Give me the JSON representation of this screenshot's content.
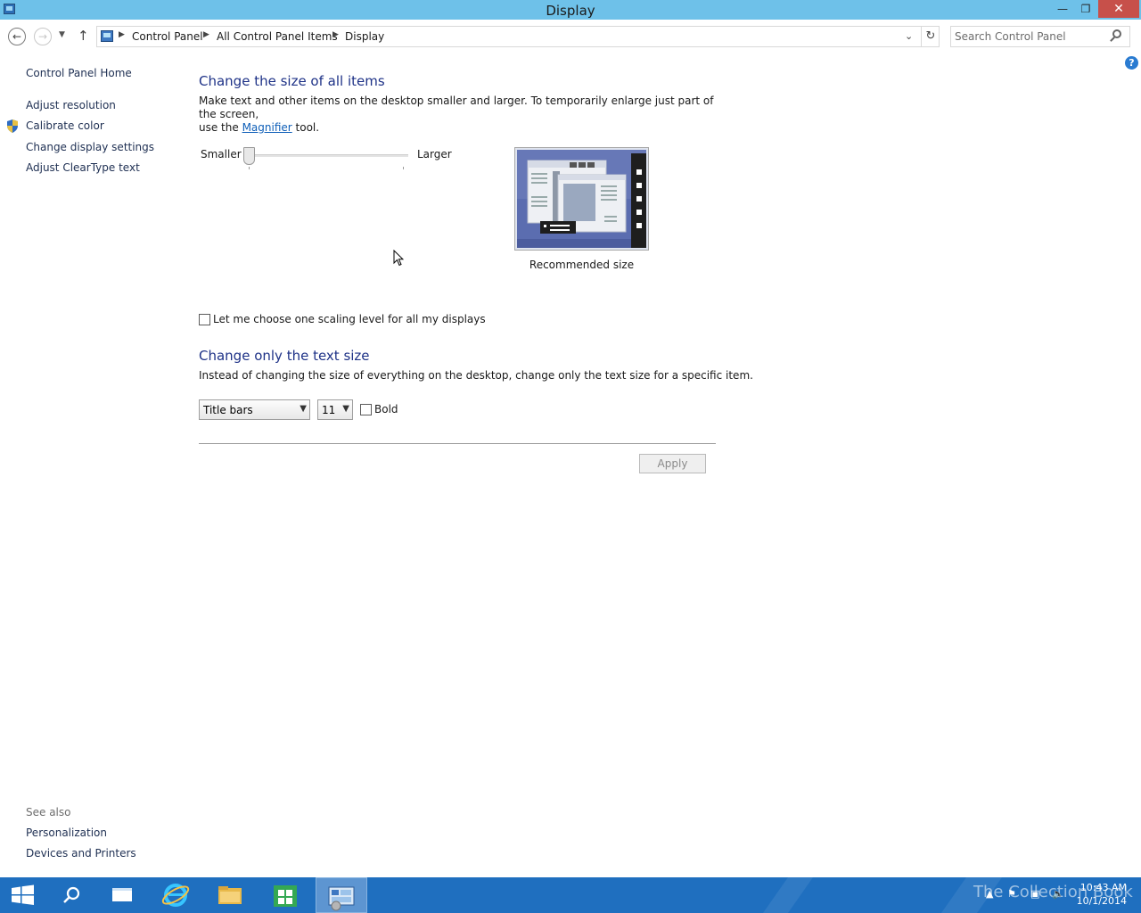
{
  "window": {
    "title": "Display"
  },
  "address": {
    "crumbs": [
      "Control Panel",
      "All Control Panel Items",
      "Display"
    ]
  },
  "search": {
    "placeholder": "Search Control Panel"
  },
  "sidebar": {
    "home": "Control Panel Home",
    "items": [
      "Adjust resolution",
      "Calibrate color",
      "Change display settings",
      "Adjust ClearType text"
    ],
    "see_also_label": "See also",
    "see_also": [
      "Personalization",
      "Devices and Printers"
    ]
  },
  "main": {
    "section1_title": "Change the size of all items",
    "section1_desc_part1": "Make text and other items on the desktop smaller and larger. To temporarily enlarge just part of the screen,",
    "section1_desc_part2": "use the",
    "magnifier_link": "Magnifier",
    "section1_desc_part3": "tool.",
    "slider": {
      "min_label": "Smaller",
      "max_label": "Larger",
      "level": 0
    },
    "preview_caption": "Recommended size",
    "scaling_checkbox_label": "Let me choose one scaling level for all my displays",
    "scaling_checked": false,
    "section2_title": "Change only the text size",
    "section2_desc": "Instead of changing the size of everything on the desktop, change only the text size for a specific item.",
    "item_select": "Title bars",
    "size_select": "11",
    "bold_label": "Bold",
    "bold_checked": false,
    "apply_label": "Apply"
  },
  "taskbar": {
    "watermark": "The Collection Book",
    "time": "10:43 AM",
    "date": "10/1/2014"
  }
}
